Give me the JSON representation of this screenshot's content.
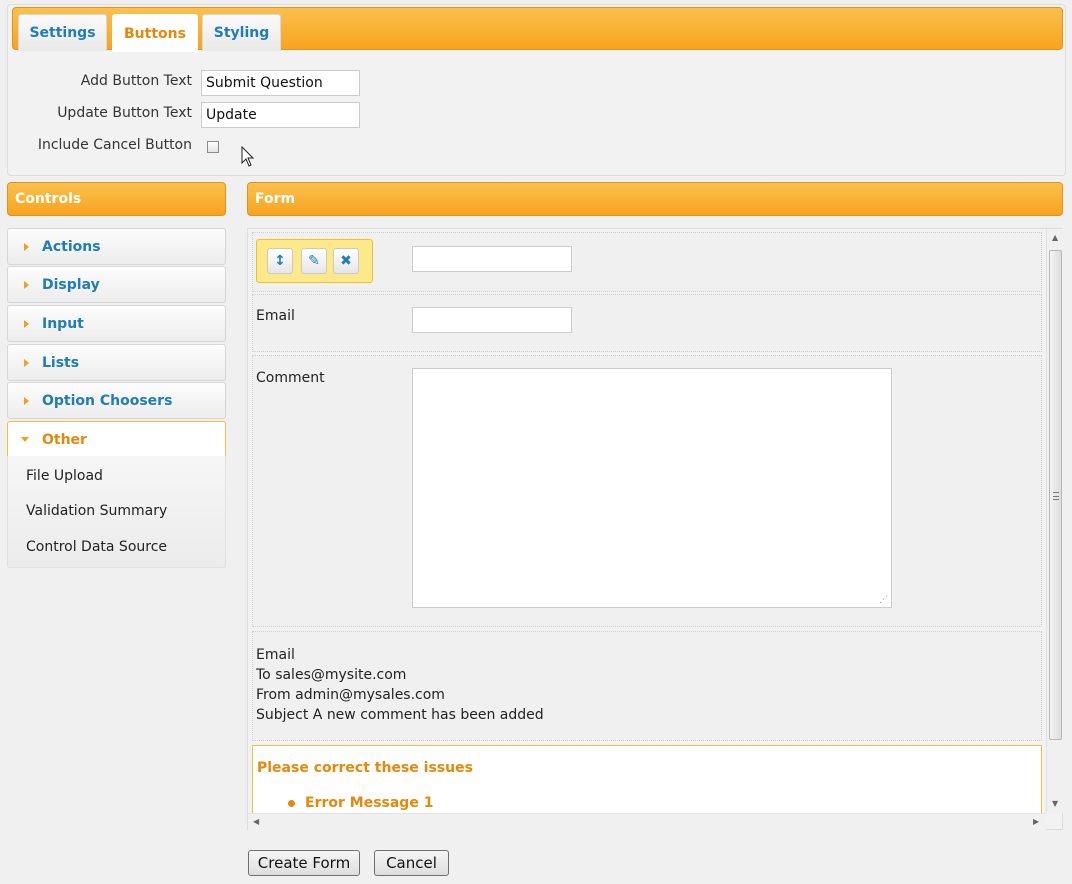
{
  "tabs": [
    {
      "label": "Settings",
      "active": false
    },
    {
      "label": "Buttons",
      "active": true
    },
    {
      "label": "Styling",
      "active": false
    }
  ],
  "settings": {
    "add_button_label": "Add Button Text",
    "add_button_value": "Submit Question",
    "update_button_label": "Update Button Text",
    "update_button_value": "Update",
    "include_cancel_label": "Include Cancel Button",
    "include_cancel_checked": false
  },
  "controls": {
    "header": "Controls",
    "groups": [
      "Actions",
      "Display",
      "Input",
      "Lists",
      "Option Choosers",
      "Other"
    ],
    "open_group": "Other",
    "other_items": [
      "File Upload",
      "Validation Summary",
      "Control Data Source"
    ]
  },
  "form": {
    "header": "Form",
    "fields": {
      "email_label": "Email",
      "comment_label": "Comment"
    },
    "email_block": {
      "title": "Email",
      "to": "To sales@mysite.com",
      "from": "From admin@mysales.com",
      "subject": "Subject A new comment has been added"
    },
    "validation": {
      "title": "Please correct these issues",
      "messages": [
        "Error Message 1"
      ]
    }
  },
  "actions": {
    "create": "Create Form",
    "cancel": "Cancel"
  }
}
